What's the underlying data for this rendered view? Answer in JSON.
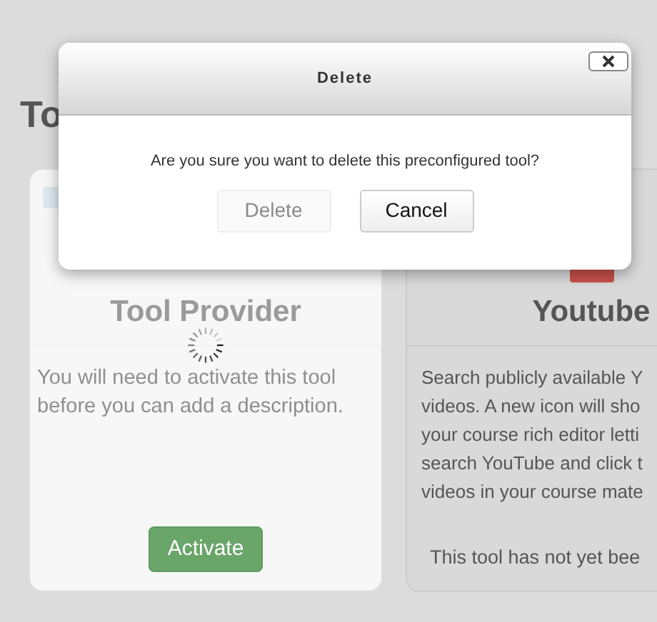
{
  "page": {
    "heading": "To"
  },
  "cards": [
    {
      "kind": "inactive",
      "title": "Tool Provider",
      "description": [
        "You will need to activate this tool",
        "before you can add a description."
      ],
      "action": "Activate",
      "loading": true
    },
    {
      "kind": "available",
      "title": "Youtube",
      "description": [
        "Search publicly available Y",
        "videos. A new icon will sho",
        "your course rich editor letti",
        "search YouTube and click t",
        "videos in your course mate"
      ],
      "footer": "This tool has not yet bee",
      "loading": false
    }
  ],
  "dialog": {
    "title": "Delete",
    "message": "Are you sure you want to delete this preconfigured tool?",
    "buttons": [
      {
        "label": "Delete",
        "disabled": true
      },
      {
        "label": "Cancel",
        "disabled": false
      }
    ]
  }
}
